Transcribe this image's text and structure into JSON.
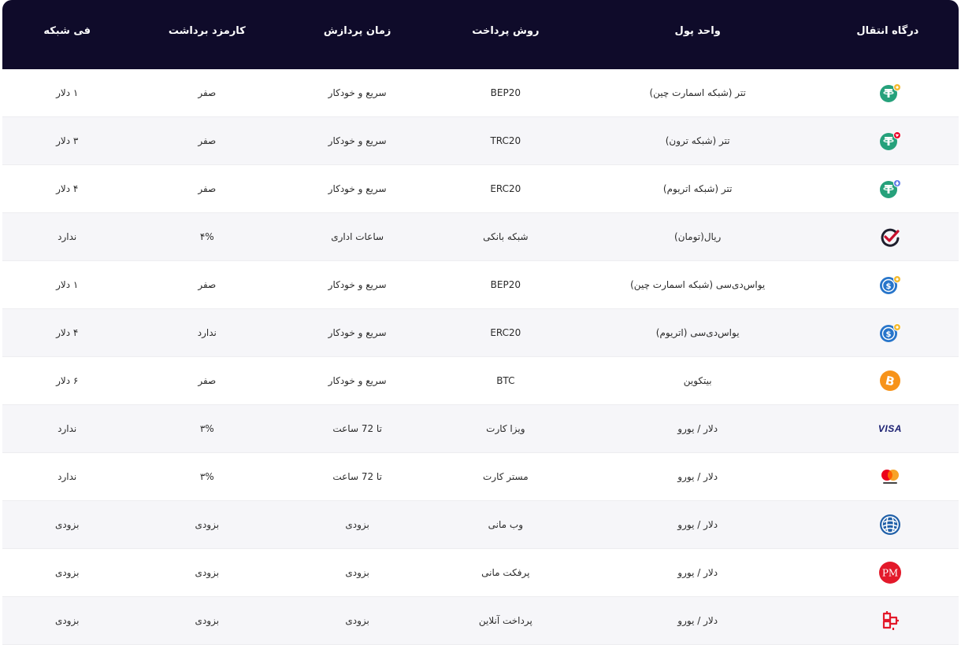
{
  "headers": {
    "gateway": "درگاه انتقال",
    "currency": "واحد پول",
    "method": "روش پرداخت",
    "time": "زمان پردازش",
    "fee": "کارمزد برداشت",
    "network": "فی شبکه"
  },
  "rows": [
    {
      "icon": "tether-bsc-icon",
      "currency": "تتر (شبکه اسمارت چین)",
      "method": "BEP20",
      "time": "سریع و خودکار",
      "fee": "صفر",
      "network": "۱ دلار"
    },
    {
      "icon": "tether-tron-icon",
      "currency": "تتر (شبکه ترون)",
      "method": "TRC20",
      "time": "سریع و خودکار",
      "fee": "صفر",
      "network": "۳ دلار"
    },
    {
      "icon": "tether-eth-icon",
      "currency": "تتر (شبکه اتریوم)",
      "method": "ERC20",
      "time": "سریع و خودکار",
      "fee": "صفر",
      "network": "۴ دلار"
    },
    {
      "icon": "rial-check-icon",
      "currency": "ریال(تومان)",
      "method": "شبکه بانکی",
      "time": "ساعات اداری",
      "fee": "۴%",
      "network": "ندارد"
    },
    {
      "icon": "usdc-bsc-icon",
      "currency": "یواس‌دی‌سی (شبکه اسمارت چین)",
      "method": "BEP20",
      "time": "سریع و خودکار",
      "fee": "صفر",
      "network": "۱ دلار"
    },
    {
      "icon": "usdc-eth-icon",
      "currency": "یواس‌دی‌سی (اتریوم)",
      "method": "ERC20",
      "time": "سریع و خودکار",
      "fee": "ندارد",
      "network": "۴ دلار"
    },
    {
      "icon": "bitcoin-icon",
      "currency": "بیتکوین",
      "method": "BTC",
      "time": "سریع و خودکار",
      "fee": "صفر",
      "network": "۶ دلار"
    },
    {
      "icon": "visa-icon",
      "icon_text": "VISA",
      "currency": "دلار / یورو",
      "method": "ویزا کارت",
      "time": "تا 72 ساعت",
      "fee": "۳%",
      "network": "ندارد"
    },
    {
      "icon": "mastercard-icon",
      "currency": "دلار / یورو",
      "method": "مستر کارت",
      "time": "تا 72 ساعت",
      "fee": "۳%",
      "network": "ندارد"
    },
    {
      "icon": "webmoney-icon",
      "currency": "دلار / یورو",
      "method": "وب مانی",
      "time": "بزودی",
      "fee": "بزودی",
      "network": "بزودی"
    },
    {
      "icon": "perfect-money-icon",
      "icon_text": "PM",
      "currency": "دلار / یورو",
      "method": "پرفکت مانی",
      "time": "بزودی",
      "fee": "بزودی",
      "network": "بزودی"
    },
    {
      "icon": "online-payment-icon",
      "currency": "دلار / یورو",
      "method": "پرداخت آنلاین",
      "time": "بزودی",
      "fee": "بزودی",
      "network": "بزودی"
    }
  ],
  "colors": {
    "header_bg": "#0f0b2a",
    "tether": "#26a17b",
    "usdc": "#2775ca",
    "bitcoin": "#f7931a",
    "visa": "#1a1f71",
    "pm_red": "#e3192a",
    "bsc_yellow": "#f3ba2f",
    "tron_red": "#eb0029",
    "eth_blue": "#627eea"
  }
}
